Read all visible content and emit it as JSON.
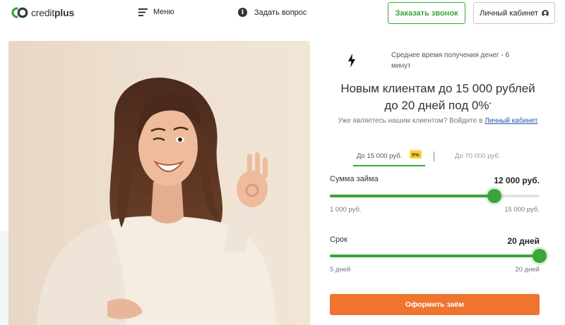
{
  "header": {
    "logo_text_light": "credit",
    "logo_text_bold": "plus",
    "menu_label": "Меню",
    "ask_label": "Задать вопрос",
    "call_button": "Заказать звонок",
    "cabinet_button": "Личный кабинет"
  },
  "offer": {
    "timing_text": "Среднее время получения денег - 6 минут",
    "headline_line1": "Новым клиентам до 15 000 рублей",
    "headline_line2": "до 20 дней под 0%",
    "headline_sup": "*",
    "existing_text": "Уже являетесь нашим клиентом? Войдите в",
    "existing_link": "Личный кабинет"
  },
  "tabs": {
    "active_label": "До 15 000 руб.",
    "active_badge": "0%",
    "inactive_label": "До 70 000 руб."
  },
  "amount": {
    "label": "Сумма займа",
    "value": "12 000 руб.",
    "min_label": "1 000 руб.",
    "max_label": "15 000 руб.",
    "min": 1000,
    "max": 15000,
    "current": 12000
  },
  "term": {
    "label": "Срок",
    "value": "20 дней",
    "min_label": "5 дней",
    "max_label": "20 дней",
    "min": 5,
    "max": 20,
    "current": 20
  },
  "apply_button": "Оформить заём",
  "colors": {
    "brand_green": "#3aa53a",
    "accent_orange": "#ee7430",
    "badge_yellow": "#ffd335",
    "link_blue": "#1f56a8"
  },
  "icons": {
    "menu": "hamburger-icon",
    "ask": "info-icon",
    "cabinet": "user-icon",
    "timing": "lightning-icon"
  }
}
